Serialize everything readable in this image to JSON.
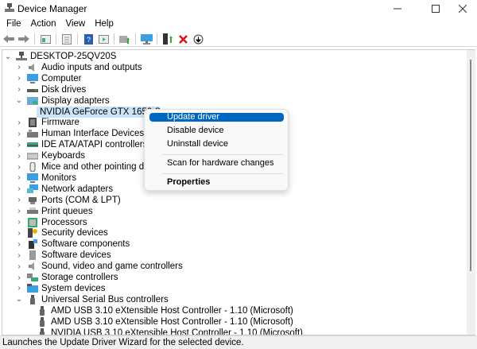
{
  "window": {
    "title": "Device Manager"
  },
  "menu": [
    "File",
    "Action",
    "View",
    "Help"
  ],
  "toolbar": [
    "back-icon",
    "forward-icon",
    "show-hide-tree-icon",
    "properties-icon",
    "help-icon",
    "run-icon",
    "scan-hardware-icon",
    "monitor-icon",
    "update-driver-icon",
    "uninstall-icon",
    "disable-icon"
  ],
  "tree": {
    "root": "DESKTOP-25QV20S",
    "items": [
      {
        "label": "Audio inputs and outputs",
        "level": 1,
        "state": "collapsed",
        "icon": "speaker"
      },
      {
        "label": "Computer",
        "level": 1,
        "state": "collapsed",
        "icon": "monitor"
      },
      {
        "label": "Disk drives",
        "level": 1,
        "state": "collapsed",
        "icon": "disk"
      },
      {
        "label": "Display adapters",
        "level": 1,
        "state": "expanded",
        "icon": "display"
      },
      {
        "label": "NVIDIA GeForce GTX 1650 SUPER",
        "level": 2,
        "state": "leaf",
        "icon": "display",
        "selected": true
      },
      {
        "label": "Firmware",
        "level": 1,
        "state": "collapsed",
        "icon": "chip"
      },
      {
        "label": "Human Interface Devices",
        "level": 1,
        "state": "collapsed",
        "icon": "hid"
      },
      {
        "label": "IDE ATA/ATAPI controllers",
        "level": 1,
        "state": "collapsed",
        "icon": "ide"
      },
      {
        "label": "Keyboards",
        "level": 1,
        "state": "collapsed",
        "icon": "keyboard"
      },
      {
        "label": "Mice and other pointing devices",
        "level": 1,
        "state": "collapsed",
        "icon": "mouse"
      },
      {
        "label": "Monitors",
        "level": 1,
        "state": "collapsed",
        "icon": "monitor"
      },
      {
        "label": "Network adapters",
        "level": 1,
        "state": "collapsed",
        "icon": "network"
      },
      {
        "label": "Ports (COM & LPT)",
        "level": 1,
        "state": "collapsed",
        "icon": "port"
      },
      {
        "label": "Print queues",
        "level": 1,
        "state": "collapsed",
        "icon": "printer"
      },
      {
        "label": "Processors",
        "level": 1,
        "state": "collapsed",
        "icon": "cpu"
      },
      {
        "label": "Security devices",
        "level": 1,
        "state": "collapsed",
        "icon": "security"
      },
      {
        "label": "Software components",
        "level": 1,
        "state": "collapsed",
        "icon": "component"
      },
      {
        "label": "Software devices",
        "level": 1,
        "state": "collapsed",
        "icon": "softdev"
      },
      {
        "label": "Sound, video and game controllers",
        "level": 1,
        "state": "collapsed",
        "icon": "speaker"
      },
      {
        "label": "Storage controllers",
        "level": 1,
        "state": "collapsed",
        "icon": "storage"
      },
      {
        "label": "System devices",
        "level": 1,
        "state": "collapsed",
        "icon": "folder"
      },
      {
        "label": "Universal Serial Bus controllers",
        "level": 1,
        "state": "expanded",
        "icon": "usb"
      },
      {
        "label": "AMD USB 3.10 eXtensible Host Controller - 1.10 (Microsoft)",
        "level": 2,
        "state": "leaf",
        "icon": "usb"
      },
      {
        "label": "AMD USB 3.10 eXtensible Host Controller - 1.10 (Microsoft)",
        "level": 2,
        "state": "leaf",
        "icon": "usb"
      },
      {
        "label": "NVIDIA USB 3.10 eXtensible Host Controller - 1.10 (Microsoft)",
        "level": 2,
        "state": "leaf",
        "icon": "usb"
      }
    ]
  },
  "context_menu": {
    "items": [
      {
        "label": "Update driver",
        "highlighted": true
      },
      {
        "label": "Disable device"
      },
      {
        "label": "Uninstall device"
      },
      {
        "label": "Scan for hardware changes"
      },
      {
        "label": "Properties",
        "bold": true
      }
    ]
  },
  "status": "Launches the Update Driver Wizard for the selected device.",
  "colors": {
    "accent": "#0067c0",
    "selection": "#cce4f7"
  }
}
